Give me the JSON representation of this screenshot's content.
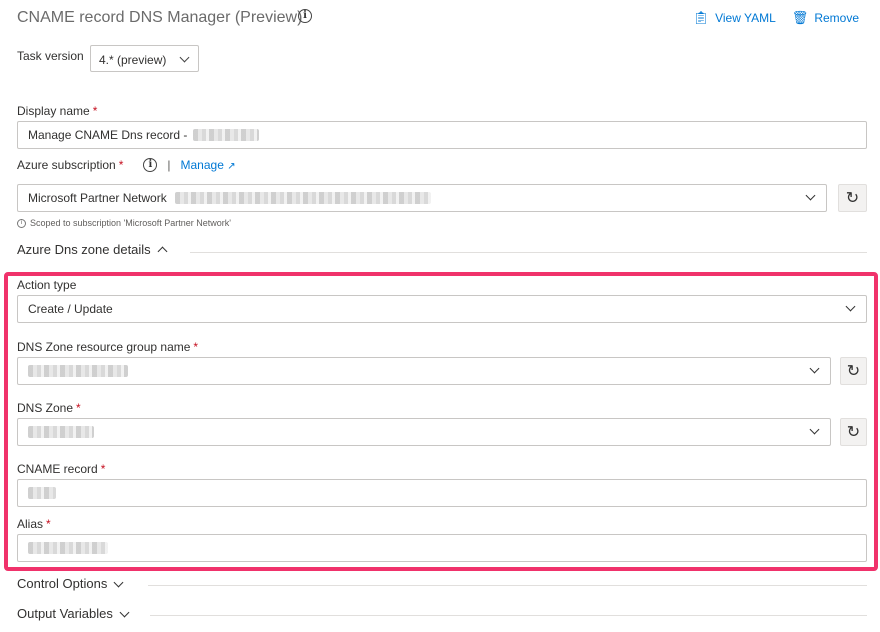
{
  "header": {
    "title": "CNAME record DNS Manager (Preview)",
    "view_yaml": "View YAML",
    "remove": "Remove"
  },
  "task_version": {
    "label": "Task version",
    "value": "4.* (preview)"
  },
  "display_name": {
    "label": "Display name",
    "required": "*",
    "value": "Manage CNAME Dns record -"
  },
  "azure_subscription": {
    "label": "Azure subscription",
    "required": "*",
    "separator": "|",
    "manage_label": "Manage",
    "value": "Microsoft Partner Network",
    "scoped_note": "Scoped to subscription 'Microsoft Partner Network'"
  },
  "dns_zone_details": {
    "heading": "Azure Dns zone details",
    "action_type": {
      "label": "Action type",
      "value": "Create / Update"
    },
    "resource_group": {
      "label": "DNS Zone resource group name",
      "required": "*"
    },
    "dns_zone": {
      "label": "DNS Zone",
      "required": "*"
    },
    "cname_record": {
      "label": "CNAME record",
      "required": "*"
    },
    "alias": {
      "label": "Alias",
      "required": "*"
    }
  },
  "control_options": {
    "heading": "Control Options"
  },
  "output_variables": {
    "heading": "Output Variables"
  },
  "colors": {
    "accent": "#0078d4",
    "highlight": "#f0326b",
    "required": "#c50f1f"
  }
}
